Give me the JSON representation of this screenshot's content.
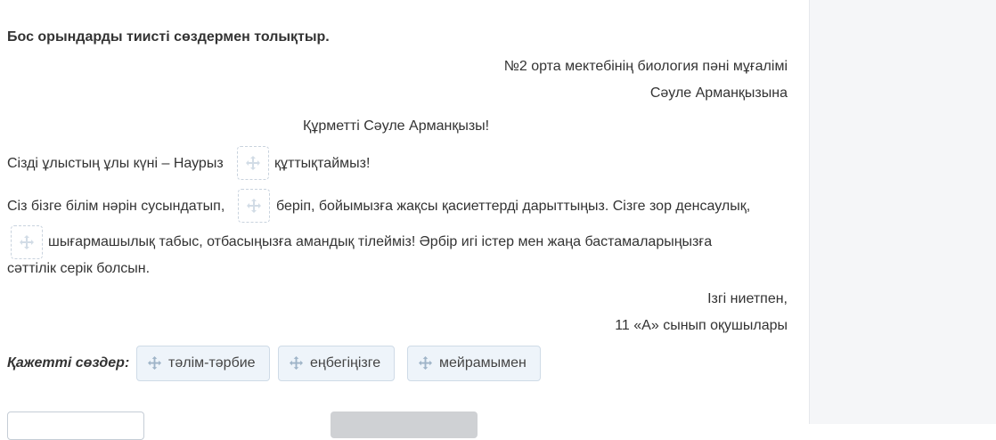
{
  "instruction": "Бос орындарды тиисті сөздермен толықтыр.",
  "letter": {
    "recipient_line1": "№2 орта мектебінің биология пәні мұғалімі",
    "recipient_line2": "Сәуле Арманқызына",
    "greeting": "Құрметті Сәуле Арманқызы!",
    "p1_before": "Сізді ұлыстың ұлы күні – Наурыз",
    "p1_after": "құттықтаймыз!",
    "p2_before": "Сіз бізге білім нәрін сусындатып,",
    "p2_after": "беріп, бойымызға жақсы қасиеттерді дарыттыңыз. Сізге зор денсаулық,",
    "p3_after": "шығармашылық табыс, отбасыңызға амандық тілейміз! Әрбір игі істер мен жаңа бастамаларыңызға",
    "p4": "сәттілік серік болсын.",
    "closing_line1": "Ізгі ниетпен,",
    "closing_line2": "11 «А» сынып оқушылары"
  },
  "words": {
    "label": "Қажетті сөздер:",
    "items": [
      "тәлім-тәрбие",
      "еңбегіңізге",
      "мейрамымен"
    ]
  },
  "icons": {
    "dropzone_icon": "move-arrows-icon",
    "chip_icon": "move-arrows-icon"
  },
  "colors": {
    "chip_bg": "#eef4fa",
    "chip_border": "#cfdbe7",
    "panel_bg": "#f5f6f8"
  }
}
